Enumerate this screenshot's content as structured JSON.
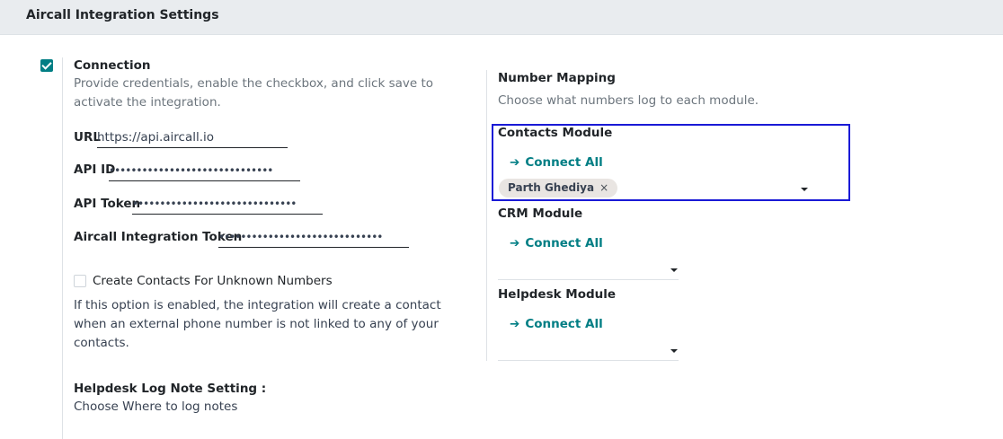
{
  "header": {
    "title": "Aircall Integration Settings"
  },
  "connection": {
    "label": "Connection",
    "checked": true,
    "help_line1": "Provide credentials, enable the checkbox, and click save to",
    "help_line2": "activate the integration.",
    "fields": {
      "url": {
        "label": "URL",
        "value": "https://api.aircall.io"
      },
      "api_id": {
        "label": "API ID",
        "value": "••••••••••••••••••••••••••••••"
      },
      "api_token": {
        "label": "API Token",
        "value": "••••••••••••••••••••••••••••••"
      },
      "integration_token": {
        "label": "Aircall Integration Token",
        "value": "••••••••••••••••••••••••••••••"
      }
    }
  },
  "unknown_numbers": {
    "label": "Create Contacts For Unknown Numbers",
    "checked": false,
    "help_line1": "If this option is enabled, the integration will create a contact",
    "help_line2": "when an external phone number is not linked to any of your",
    "help_line3": "contacts."
  },
  "helpdesk_log": {
    "label": "Helpdesk Log Note Setting :",
    "help": "Choose Where to log notes"
  },
  "number_mapping": {
    "title": "Number Mapping",
    "help": "Choose what numbers log to each module.",
    "modules": {
      "contacts": {
        "label": "Contacts Module",
        "connect_label": "Connect All",
        "tag": "Parth Ghediya",
        "tag_remove": "×"
      },
      "crm": {
        "label": "CRM Module",
        "connect_label": "Connect All"
      },
      "helpdesk": {
        "label": "Helpdesk Module",
        "connect_label": "Connect All"
      }
    }
  },
  "colors": {
    "accent": "#017e84",
    "highlight": "#1a1ad6",
    "header_bg": "#e9ecef"
  },
  "icons": {
    "check": "check-icon",
    "arrow": "arrow-right-icon",
    "caret": "caret-down-icon",
    "remove": "close-icon"
  }
}
